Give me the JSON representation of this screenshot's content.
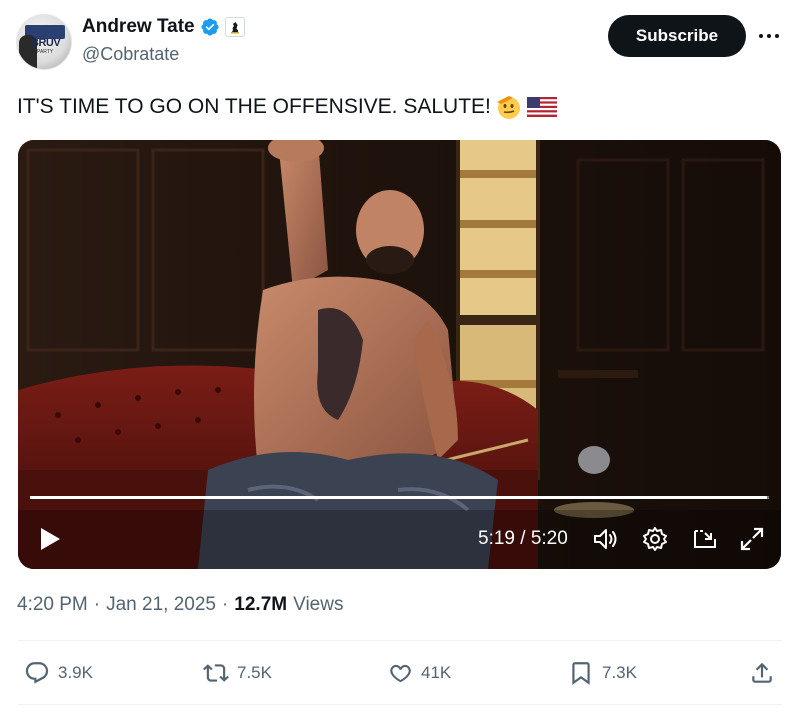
{
  "author": {
    "name": "Andrew Tate",
    "handle": "@Cobratate",
    "avatar_text": "BRUV",
    "avatar_subtext": "PARTY",
    "verified_color": "#1d9bf0"
  },
  "header": {
    "subscribe_label": "Subscribe",
    "more_icon": "more-dots-icon"
  },
  "tweet": {
    "text": "IT'S TIME TO GO ON THE OFFENSIVE. SALUTE!",
    "emojis": [
      "saluting-face-emoji",
      "us-flag-emoji"
    ]
  },
  "video": {
    "time_display": "5:19 / 5:20",
    "progress": 0.997,
    "controls": [
      "play-icon",
      "volume-icon",
      "settings-icon",
      "pip-icon",
      "fullscreen-icon"
    ]
  },
  "meta": {
    "time": "4:20 PM",
    "date": "Jan 21, 2025",
    "separator": "·",
    "views_count": "12.7M",
    "views_label": "Views"
  },
  "actions": {
    "replies": "3.9K",
    "reposts": "7.5K",
    "likes": "41K",
    "bookmarks": "7.3K"
  },
  "colors": {
    "text_primary": "#0f1419",
    "text_secondary": "#536471",
    "accent": "#1d9bf0",
    "divider": "#eff3f4"
  }
}
